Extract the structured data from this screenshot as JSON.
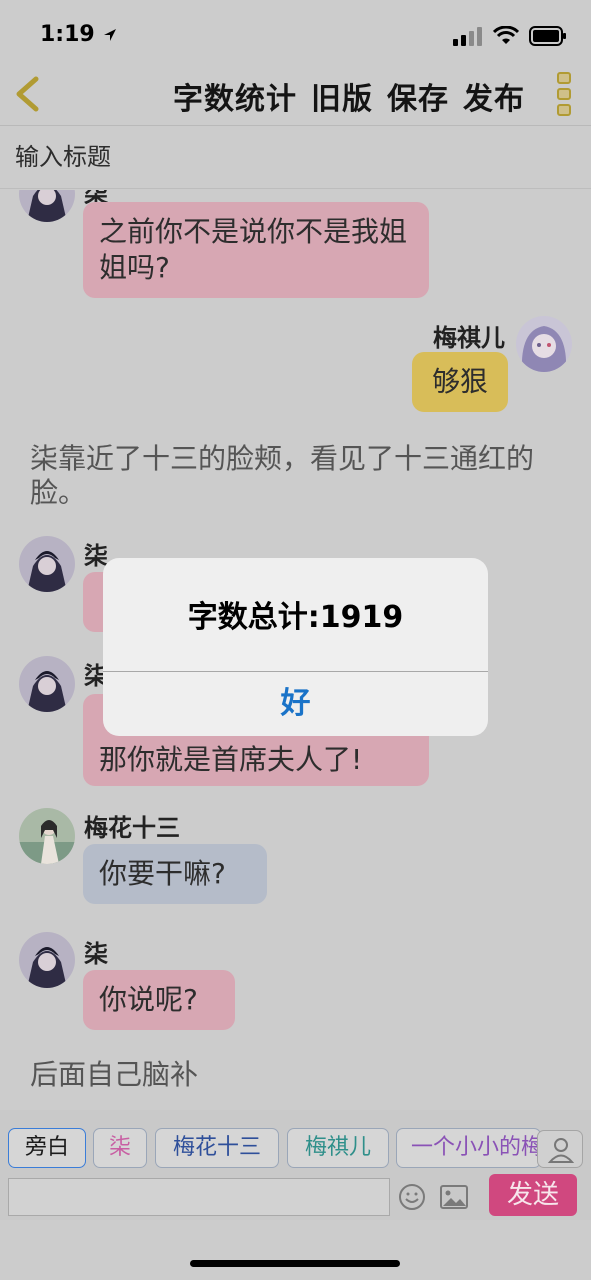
{
  "status": {
    "time": "1:19"
  },
  "header": {
    "actions": [
      "字数统计",
      "旧版",
      "保存",
      "发布"
    ],
    "title_placeholder": "输入标题"
  },
  "messages": {
    "m1_name": "柒",
    "m1_text": "之前你不是说你不是我姐姐吗?",
    "m2_name": "梅祺儿",
    "m2_text": "够狠",
    "narration1": "柒靠近了十三的脸颊，看见了十三通红的脸。",
    "m3_name": "柒",
    "m4_name": "柒",
    "m4_text": "那你就是首席夫人了!",
    "m5_name": "梅花十三",
    "m5_text": "你要干嘛?",
    "m6_name": "柒",
    "m6_text": "你说呢?",
    "narration2": "后面自己脑补"
  },
  "dialog": {
    "title": "字数总计:1919",
    "ok": "好"
  },
  "speakers": [
    "旁白",
    "柒",
    "梅花十三",
    "梅祺儿",
    "一个小小的梅"
  ],
  "composer": {
    "send": "发送"
  },
  "colors": {
    "accent_pink": "#d0487f",
    "back_gold": "#b19b33",
    "dialog_blue": "#1a73c8"
  }
}
